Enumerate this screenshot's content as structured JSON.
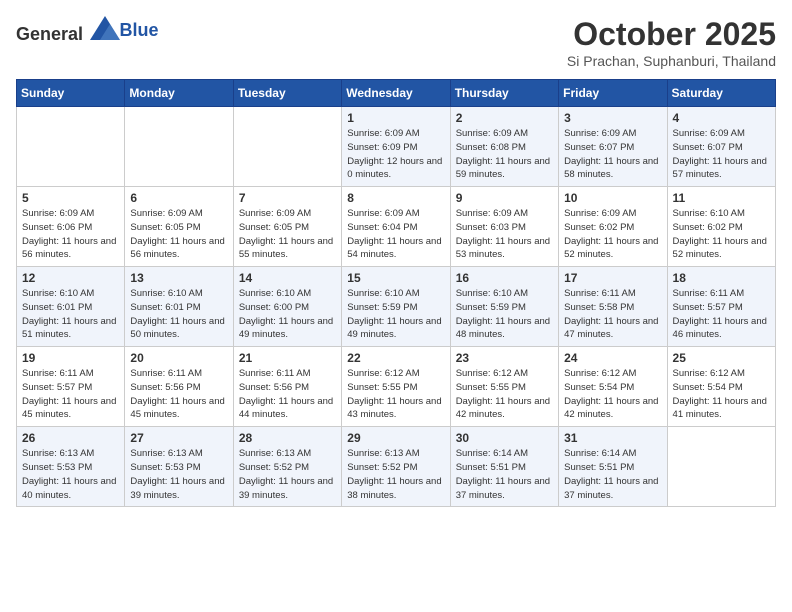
{
  "header": {
    "logo_general": "General",
    "logo_blue": "Blue",
    "title": "October 2025",
    "subtitle": "Si Prachan, Suphanburi, Thailand"
  },
  "days_of_week": [
    "Sunday",
    "Monday",
    "Tuesday",
    "Wednesday",
    "Thursday",
    "Friday",
    "Saturday"
  ],
  "weeks": [
    [
      {
        "day": "",
        "info": ""
      },
      {
        "day": "",
        "info": ""
      },
      {
        "day": "",
        "info": ""
      },
      {
        "day": "1",
        "info": "Sunrise: 6:09 AM\nSunset: 6:09 PM\nDaylight: 12 hours\nand 0 minutes."
      },
      {
        "day": "2",
        "info": "Sunrise: 6:09 AM\nSunset: 6:08 PM\nDaylight: 11 hours\nand 59 minutes."
      },
      {
        "day": "3",
        "info": "Sunrise: 6:09 AM\nSunset: 6:07 PM\nDaylight: 11 hours\nand 58 minutes."
      },
      {
        "day": "4",
        "info": "Sunrise: 6:09 AM\nSunset: 6:07 PM\nDaylight: 11 hours\nand 57 minutes."
      }
    ],
    [
      {
        "day": "5",
        "info": "Sunrise: 6:09 AM\nSunset: 6:06 PM\nDaylight: 11 hours\nand 56 minutes."
      },
      {
        "day": "6",
        "info": "Sunrise: 6:09 AM\nSunset: 6:05 PM\nDaylight: 11 hours\nand 56 minutes."
      },
      {
        "day": "7",
        "info": "Sunrise: 6:09 AM\nSunset: 6:05 PM\nDaylight: 11 hours\nand 55 minutes."
      },
      {
        "day": "8",
        "info": "Sunrise: 6:09 AM\nSunset: 6:04 PM\nDaylight: 11 hours\nand 54 minutes."
      },
      {
        "day": "9",
        "info": "Sunrise: 6:09 AM\nSunset: 6:03 PM\nDaylight: 11 hours\nand 53 minutes."
      },
      {
        "day": "10",
        "info": "Sunrise: 6:09 AM\nSunset: 6:02 PM\nDaylight: 11 hours\nand 52 minutes."
      },
      {
        "day": "11",
        "info": "Sunrise: 6:10 AM\nSunset: 6:02 PM\nDaylight: 11 hours\nand 52 minutes."
      }
    ],
    [
      {
        "day": "12",
        "info": "Sunrise: 6:10 AM\nSunset: 6:01 PM\nDaylight: 11 hours\nand 51 minutes."
      },
      {
        "day": "13",
        "info": "Sunrise: 6:10 AM\nSunset: 6:01 PM\nDaylight: 11 hours\nand 50 minutes."
      },
      {
        "day": "14",
        "info": "Sunrise: 6:10 AM\nSunset: 6:00 PM\nDaylight: 11 hours\nand 49 minutes."
      },
      {
        "day": "15",
        "info": "Sunrise: 6:10 AM\nSunset: 5:59 PM\nDaylight: 11 hours\nand 49 minutes."
      },
      {
        "day": "16",
        "info": "Sunrise: 6:10 AM\nSunset: 5:59 PM\nDaylight: 11 hours\nand 48 minutes."
      },
      {
        "day": "17",
        "info": "Sunrise: 6:11 AM\nSunset: 5:58 PM\nDaylight: 11 hours\nand 47 minutes."
      },
      {
        "day": "18",
        "info": "Sunrise: 6:11 AM\nSunset: 5:57 PM\nDaylight: 11 hours\nand 46 minutes."
      }
    ],
    [
      {
        "day": "19",
        "info": "Sunrise: 6:11 AM\nSunset: 5:57 PM\nDaylight: 11 hours\nand 45 minutes."
      },
      {
        "day": "20",
        "info": "Sunrise: 6:11 AM\nSunset: 5:56 PM\nDaylight: 11 hours\nand 45 minutes."
      },
      {
        "day": "21",
        "info": "Sunrise: 6:11 AM\nSunset: 5:56 PM\nDaylight: 11 hours\nand 44 minutes."
      },
      {
        "day": "22",
        "info": "Sunrise: 6:12 AM\nSunset: 5:55 PM\nDaylight: 11 hours\nand 43 minutes."
      },
      {
        "day": "23",
        "info": "Sunrise: 6:12 AM\nSunset: 5:55 PM\nDaylight: 11 hours\nand 42 minutes."
      },
      {
        "day": "24",
        "info": "Sunrise: 6:12 AM\nSunset: 5:54 PM\nDaylight: 11 hours\nand 42 minutes."
      },
      {
        "day": "25",
        "info": "Sunrise: 6:12 AM\nSunset: 5:54 PM\nDaylight: 11 hours\nand 41 minutes."
      }
    ],
    [
      {
        "day": "26",
        "info": "Sunrise: 6:13 AM\nSunset: 5:53 PM\nDaylight: 11 hours\nand 40 minutes."
      },
      {
        "day": "27",
        "info": "Sunrise: 6:13 AM\nSunset: 5:53 PM\nDaylight: 11 hours\nand 39 minutes."
      },
      {
        "day": "28",
        "info": "Sunrise: 6:13 AM\nSunset: 5:52 PM\nDaylight: 11 hours\nand 39 minutes."
      },
      {
        "day": "29",
        "info": "Sunrise: 6:13 AM\nSunset: 5:52 PM\nDaylight: 11 hours\nand 38 minutes."
      },
      {
        "day": "30",
        "info": "Sunrise: 6:14 AM\nSunset: 5:51 PM\nDaylight: 11 hours\nand 37 minutes."
      },
      {
        "day": "31",
        "info": "Sunrise: 6:14 AM\nSunset: 5:51 PM\nDaylight: 11 hours\nand 37 minutes."
      },
      {
        "day": "",
        "info": ""
      }
    ]
  ]
}
